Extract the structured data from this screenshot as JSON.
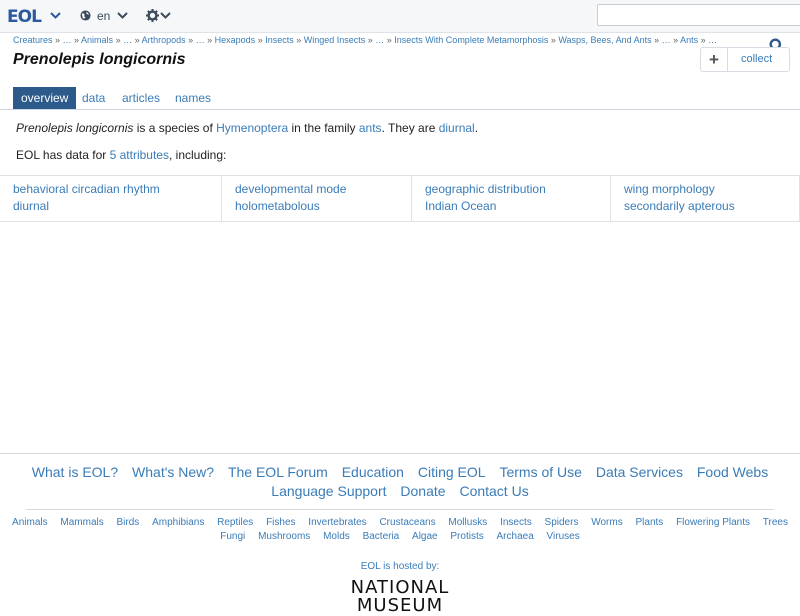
{
  "navbar": {
    "logo": "EOL",
    "language": "en",
    "search_placeholder": ""
  },
  "breadcrumbs": [
    "Creatures",
    "…",
    "Animals",
    "…",
    "Arthropods",
    "…",
    "Hexapods",
    "Insects",
    "Winged Insects",
    "…",
    "Insects With Complete Metamorphosis",
    "Wasps, Bees, And Ants",
    "…",
    "Ants",
    "…"
  ],
  "page": {
    "title": "Prenolepis longicornis",
    "collect_label": "collect"
  },
  "tabs": [
    {
      "label": "overview",
      "active": true
    },
    {
      "label": "data",
      "active": false
    },
    {
      "label": "articles",
      "active": false
    },
    {
      "label": "names",
      "active": false
    }
  ],
  "summary": {
    "name": "Prenolepis longicornis",
    "t1": " is a species of ",
    "order": "Hymenoptera",
    "t2": " in the family ",
    "family": "ants",
    "t3": ". They are ",
    "trait": "diurnal",
    "t4": "."
  },
  "attributes_line": {
    "t1": "EOL has data for ",
    "link": "5 attributes",
    "t2": ", including:"
  },
  "data_cells": [
    {
      "attribute": "behavioral circadian rhythm",
      "value": "diurnal"
    },
    {
      "attribute": "developmental mode",
      "value": "holometabolous"
    },
    {
      "attribute": "geographic distribution",
      "value": "Indian Ocean"
    },
    {
      "attribute": "wing morphology",
      "value": "secondarily apterous"
    }
  ],
  "footer_links": [
    "What is EOL?",
    "What's New?",
    "The EOL Forum",
    "Education",
    "Citing EOL",
    "Terms of Use",
    "Data Services",
    "Food Webs",
    "Language Support",
    "Donate",
    "Contact Us"
  ],
  "taxa_links": [
    "Animals",
    "Mammals",
    "Birds",
    "Amphibians",
    "Reptiles",
    "Fishes",
    "Invertebrates",
    "Crustaceans",
    "Mollusks",
    "Insects",
    "Spiders",
    "Worms",
    "Plants",
    "Flowering Plants",
    "Trees",
    "Fungi",
    "Mushrooms",
    "Molds",
    "Bacteria",
    "Algae",
    "Protists",
    "Archaea",
    "Viruses"
  ],
  "hosted_by": "EOL is hosted by:",
  "host_logo_text": "NATIONAL MUSEUM"
}
